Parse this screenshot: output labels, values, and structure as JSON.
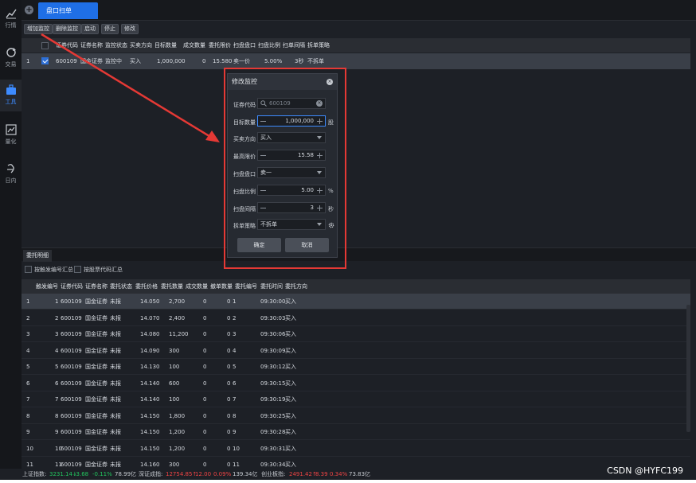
{
  "sidebar": {
    "items": [
      {
        "label": "行情",
        "icon": "chart-line-icon"
      },
      {
        "label": "交易",
        "icon": "refresh-icon"
      },
      {
        "label": "工具",
        "icon": "briefcase-icon"
      },
      {
        "label": "量化",
        "icon": "quant-icon"
      },
      {
        "label": "日内",
        "icon": "intraday-icon"
      }
    ],
    "active_index": 2
  },
  "tabs": {
    "active_label": "盘口扫单"
  },
  "toolbar": {
    "add": "增加监控",
    "delete": "删除监控",
    "start": "启动",
    "stop": "停止",
    "modify": "修改"
  },
  "monitor_table": {
    "headers": [
      "证券代码",
      "证券名称",
      "监控状态",
      "买卖方向",
      "目标数量",
      "成交数量",
      "委托限价",
      "扫盘盘口",
      "扫盘比例",
      "扫单间隔",
      "拆单策略"
    ],
    "rows": [
      {
        "idx": "1",
        "code": "600109",
        "name": "国金证券",
        "status": "监控中",
        "side": "买入",
        "target": "1,000,000",
        "filled": "0",
        "limit": "15.580",
        "level": "卖一价",
        "ratio": "5.00%",
        "interval": "3秒",
        "strategy": "不拆单"
      }
    ]
  },
  "modal": {
    "title": "修改监控",
    "fields": {
      "code_label": "证券代码",
      "code_value": "600109",
      "qty_label": "目标数量",
      "qty_value": "1,000,000",
      "qty_unit": "股",
      "side_label": "买卖方向",
      "side_value": "买入",
      "price_label": "最高限价",
      "price_value": "15.58",
      "level_label": "扫盘盘口",
      "level_value": "卖一",
      "ratio_label": "扫盘比例",
      "ratio_value": "5.00",
      "ratio_unit": "%",
      "interval_label": "扫盘间隔",
      "interval_value": "3",
      "interval_unit": "秒",
      "strategy_label": "拆单策略",
      "strategy_value": "不拆单"
    },
    "ok": "确定",
    "cancel": "取消"
  },
  "bottom": {
    "tab": "委托明细",
    "option1": "按触发编号汇总",
    "option2": "按股票代码汇总",
    "headers": [
      "触发编号",
      "证券代码",
      "证券名称",
      "委托状态",
      "委托价格",
      "委托数量",
      "成交数量",
      "撤单数量",
      "委托编号",
      "委托时间",
      "委托方向"
    ],
    "rows": [
      {
        "idx": "1",
        "trig": "1",
        "code": "600109",
        "name": "国金证券",
        "status": "未报",
        "price": "14.050",
        "qty": "2,700",
        "filled": "0",
        "cancel": "0",
        "no": "1",
        "time": "09:30:00",
        "side": "买入"
      },
      {
        "idx": "2",
        "trig": "2",
        "code": "600109",
        "name": "国金证券",
        "status": "未报",
        "price": "14.070",
        "qty": "2,400",
        "filled": "0",
        "cancel": "0",
        "no": "2",
        "time": "09:30:03",
        "side": "买入"
      },
      {
        "idx": "3",
        "trig": "3",
        "code": "600109",
        "name": "国金证券",
        "status": "未报",
        "price": "14.080",
        "qty": "11,200",
        "filled": "0",
        "cancel": "0",
        "no": "3",
        "time": "09:30:06",
        "side": "买入"
      },
      {
        "idx": "4",
        "trig": "4",
        "code": "600109",
        "name": "国金证券",
        "status": "未报",
        "price": "14.090",
        "qty": "300",
        "filled": "0",
        "cancel": "0",
        "no": "4",
        "time": "09:30:09",
        "side": "买入"
      },
      {
        "idx": "5",
        "trig": "5",
        "code": "600109",
        "name": "国金证券",
        "status": "未报",
        "price": "14.130",
        "qty": "100",
        "filled": "0",
        "cancel": "0",
        "no": "5",
        "time": "09:30:12",
        "side": "买入"
      },
      {
        "idx": "6",
        "trig": "6",
        "code": "600109",
        "name": "国金证券",
        "status": "未报",
        "price": "14.140",
        "qty": "600",
        "filled": "0",
        "cancel": "0",
        "no": "6",
        "time": "09:30:15",
        "side": "买入"
      },
      {
        "idx": "7",
        "trig": "7",
        "code": "600109",
        "name": "国金证券",
        "status": "未报",
        "price": "14.140",
        "qty": "100",
        "filled": "0",
        "cancel": "0",
        "no": "7",
        "time": "09:30:19",
        "side": "买入"
      },
      {
        "idx": "8",
        "trig": "8",
        "code": "600109",
        "name": "国金证券",
        "status": "未报",
        "price": "14.150",
        "qty": "1,800",
        "filled": "0",
        "cancel": "0",
        "no": "8",
        "time": "09:30:25",
        "side": "买入"
      },
      {
        "idx": "9",
        "trig": "9",
        "code": "600109",
        "name": "国金证券",
        "status": "未报",
        "price": "14.150",
        "qty": "1,200",
        "filled": "0",
        "cancel": "0",
        "no": "9",
        "time": "09:30:28",
        "side": "买入"
      },
      {
        "idx": "10",
        "trig": "10",
        "code": "600109",
        "name": "国金证券",
        "status": "未报",
        "price": "14.150",
        "qty": "1,200",
        "filled": "0",
        "cancel": "0",
        "no": "10",
        "time": "09:30:31",
        "side": "买入"
      },
      {
        "idx": "11",
        "trig": "11",
        "code": "600109",
        "name": "国金证券",
        "status": "未报",
        "price": "14.160",
        "qty": "300",
        "filled": "0",
        "cancel": "0",
        "no": "11",
        "time": "09:30:34",
        "side": "买入"
      }
    ]
  },
  "status": {
    "sh_label": "上证指数:",
    "sh_value": "3231.14",
    "sh_change": "-3.68",
    "sh_pct": "-0.11%",
    "sh_amount": "78.99亿",
    "sz_label": "深证成指:",
    "sz_value": "12754.85",
    "sz_change": "12.00",
    "sz_pct": "0.09%",
    "sz_amount": "139.34亿",
    "cy_label": "创业板指:",
    "cy_value": "2491.42",
    "cy_change": "8.39",
    "cy_pct": "0.34%",
    "cy_amount": "73.83亿"
  },
  "watermark": "CSDN @HYFC199",
  "colors": {
    "accent": "#1f6fe6",
    "annotation_red": "#e53935",
    "up": "#ef4444",
    "down": "#22c55e"
  }
}
